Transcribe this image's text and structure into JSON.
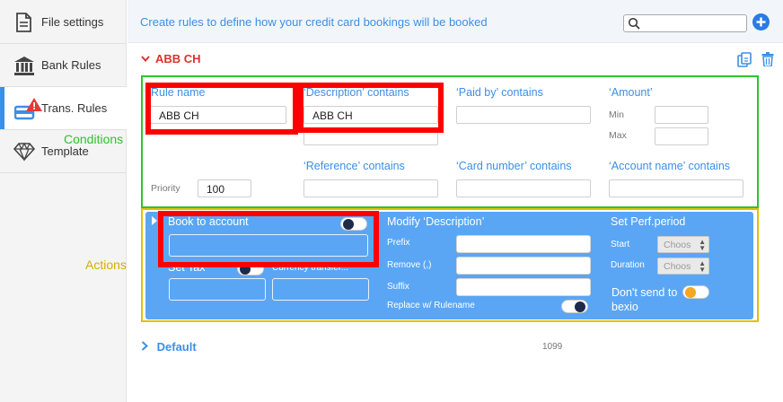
{
  "sidebar": {
    "items": [
      {
        "label": "File settings",
        "icon": "file-icon"
      },
      {
        "label": "Bank Rules",
        "icon": "bank-icon"
      },
      {
        "label": "Trans. Rules",
        "icon": "card-alert-icon",
        "active": true
      },
      {
        "label": "Template",
        "icon": "diamond-icon"
      }
    ]
  },
  "topbar": {
    "description": "Create rules to define how your credit card bookings will be booked",
    "search_placeholder": ""
  },
  "rule": {
    "name": "ABB CH",
    "conditions": {
      "rule_name_label": "Rule name",
      "rule_name_value": "ABB CH",
      "description_label": "‘Description’ contains",
      "description_value": "ABB CH",
      "paid_by_label": "‘Paid by’ contains",
      "amount_label": "‘Amount’",
      "min_label": "Min",
      "max_label": "Max",
      "priority_label": "Priority",
      "priority_value": "100",
      "reference_label": "‘Reference’ contains",
      "card_number_label": "‘Card number’ contains",
      "account_name_label": "‘Account name’ contains"
    },
    "actions": {
      "book_to_account_label": "Book to account",
      "set_tax_label": "Set Tax",
      "currency_transfer_label": "Currency transfer...",
      "modify_description_label": "Modify ‘Description’",
      "prefix_label": "Prefix",
      "remove_label": "Remove (,)",
      "suffix_label": "Suffix",
      "replace_label": "Replace w/ Rulename",
      "set_perf_label": "Set Perf.period",
      "start_label": "Start",
      "duration_label": "Duration",
      "start_select": "Choos",
      "duration_select": "Choos",
      "dont_send_label_1": "Don't send to",
      "dont_send_label_2": "bexio"
    }
  },
  "annotations": {
    "conditions": "Conditions",
    "actions": "Actions"
  },
  "default_rule": {
    "label": "Default",
    "count": "1099"
  },
  "colors": {
    "accent": "#3b8fe8",
    "rule_name_red": "#d9342b",
    "conditions_outline": "#2ec42e",
    "actions_outline": "#e3c000",
    "actions_panel": "#5aa6f5",
    "highlight": "#ff0000"
  }
}
